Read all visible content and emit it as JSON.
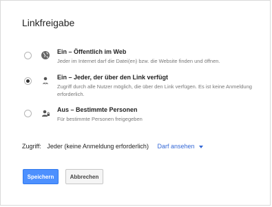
{
  "dialog": {
    "title": "Linkfreigabe"
  },
  "options": [
    {
      "title": "Ein – Öffentlich im Web",
      "description": "Jeder im Internet darf die Datei(en) bzw. die Website finden und öffnen.",
      "icon": "globe-icon",
      "selected": false
    },
    {
      "title": "Ein – Jeder, der über den Link verfügt",
      "description": "Zugriff durch alle Nutzer möglich, die über den Link verfügen. Es ist keine Anmeldung erforderlich.",
      "icon": "link-icon",
      "selected": true
    },
    {
      "title": "Aus – Bestimmte Personen",
      "description": "Für bestimmte Personen freigegeben",
      "icon": "person-lock-icon",
      "selected": false
    }
  ],
  "access": {
    "label": "Zugriff:",
    "value": "Jeder (keine Anmeldung erforderlich)",
    "permission": "Darf ansehen"
  },
  "buttons": {
    "save": "Speichern",
    "cancel": "Abbrechen"
  },
  "colors": {
    "accent": "#4d90fe",
    "link": "#3367d6"
  }
}
